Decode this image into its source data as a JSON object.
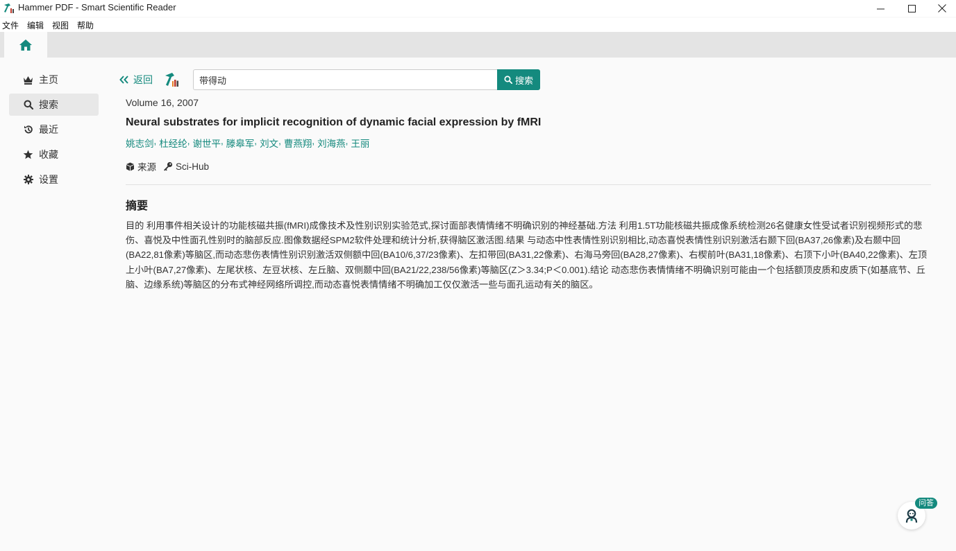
{
  "window": {
    "title": "Hammer PDF - Smart Scientific Reader"
  },
  "menu": [
    "文件",
    "编辑",
    "视图",
    "帮助"
  ],
  "sidebar": {
    "items": [
      {
        "label": "主页",
        "icon": "chess-queen-icon"
      },
      {
        "label": "搜索",
        "icon": "search-icon"
      },
      {
        "label": "最近",
        "icon": "history-icon"
      },
      {
        "label": "收藏",
        "icon": "star-icon"
      },
      {
        "label": "设置",
        "icon": "gear-icon"
      }
    ],
    "active_index": 1
  },
  "search": {
    "back_label": "返回",
    "query": "带得动",
    "button_label": "搜索"
  },
  "paper": {
    "volume": "Volume 16, 2007",
    "title": "Neural substrates for implicit recognition of dynamic facial expression by fMRI",
    "authors": [
      "姚志剑",
      "杜经纶",
      "谢世平",
      "滕皋军",
      "刘文",
      "曹燕翔",
      "刘海燕",
      "王丽"
    ],
    "source_label": "来源",
    "scihub_label": "Sci-Hub"
  },
  "abstract": {
    "heading": "摘要",
    "text": "目的 利用事件相关设计的功能核磁共振(fMRI)成像技术及性别识别实验范式,探讨面部表情情绪不明确识别的神经基础.方法 利用1.5T功能核磁共振成像系统检测26名健康女性受试者识别视频形式的悲伤、喜悦及中性面孔性别时的脑部反应.图像数据经SPM2软件处理和统计分析,获得脑区激活图.结果 与动态中性表情性别识别相比,动态喜悦表情性别识别激活右颞下回(BA37,26像素)及右颞中回(BA22,81像素)等脑区,而动态悲伤表情性别识别激活双侧额中回(BA10/6,37/23像素)、左扣带回(BA31,22像素)、右海马旁回(BA28,27像素)、右楔前叶(BA31,18像素)、右顶下小叶(BA40,22像素)、左顶上小叶(BA7,27像素)、左尾状核、左豆状核、左丘脑、双侧颞中回(BA21/22,238/56像素)等脑区(Z＞3.34;P＜0.001).结论 动态悲伤表情情绪不明确识别可能由一个包括额顶皮质和皮质下(如基底节、丘脑、边缘系统)等脑区的分布式神经网络所调控,而动态喜悦表情情绪不明确加工仅仅激活一些与面孔运动有关的脑区。"
  },
  "assistant": {
    "badge": "问答",
    "icon": "robot-icon"
  },
  "colors": {
    "accent": "#148a7e",
    "link": "#14897d",
    "tabstrip": "#e4e4e4",
    "background": "#fafafa"
  }
}
